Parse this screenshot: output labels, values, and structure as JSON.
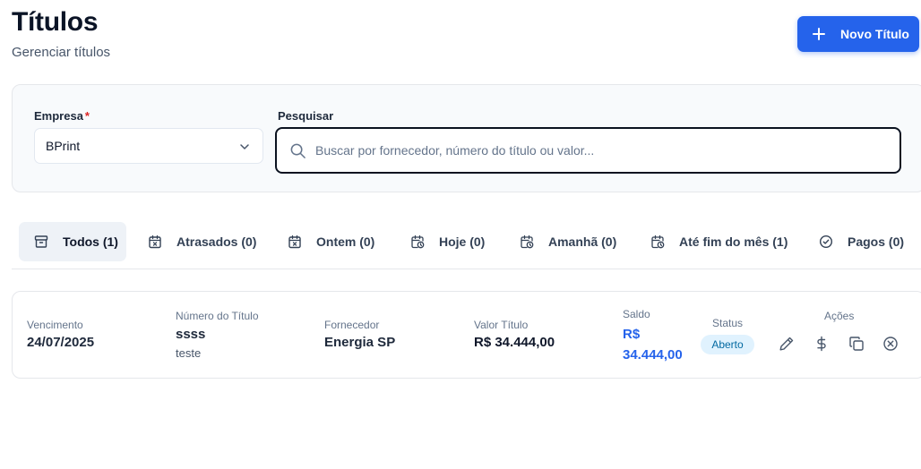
{
  "header": {
    "title": "Títulos",
    "subtitle": "Gerenciar títulos",
    "new_button_label": "Novo Título"
  },
  "filters": {
    "company_label": "Empresa",
    "company_required_mark": "*",
    "company_value": "BPrint",
    "search_label": "Pesquisar",
    "search_placeholder": "Buscar por fornecedor, número do título ou valor...",
    "search_value": ""
  },
  "tabs": [
    {
      "label": "Todos (1)",
      "icon": "archive-icon",
      "active": true
    },
    {
      "label": "Atrasados (0)",
      "icon": "calendar-x-icon",
      "active": false
    },
    {
      "label": "Ontem (0)",
      "icon": "calendar-x-icon",
      "active": false
    },
    {
      "label": "Hoje (0)",
      "icon": "calendar-clock-icon",
      "active": false
    },
    {
      "label": "Amanhã (0)",
      "icon": "calendar-clock-icon",
      "active": false
    },
    {
      "label": "Até fim do mês (1)",
      "icon": "calendar-clock-icon",
      "active": false
    },
    {
      "label": "Pagos (0)",
      "icon": "check-circle-icon",
      "active": false
    }
  ],
  "row": {
    "due_label": "Vencimento",
    "due_value": "24/07/2025",
    "number_label": "Número do Título",
    "number_value": "ssss",
    "number_desc": "teste",
    "supplier_label": "Fornecedor",
    "supplier_value": "Energia SP",
    "amount_label": "Valor Título",
    "amount_value": "R$ 34.444,00",
    "balance_label": "Saldo",
    "balance_value": "R$ 34.444,00",
    "status_label": "Status",
    "status_value": "Aberto",
    "actions_label": "Ações",
    "actions": [
      "edit-icon",
      "dollar-icon",
      "copy-icon",
      "cancel-icon"
    ]
  },
  "colors": {
    "primary": "#2563eb",
    "badge_bg": "#e0f2fe",
    "badge_text": "#0369a1",
    "required": "#dc2626"
  }
}
